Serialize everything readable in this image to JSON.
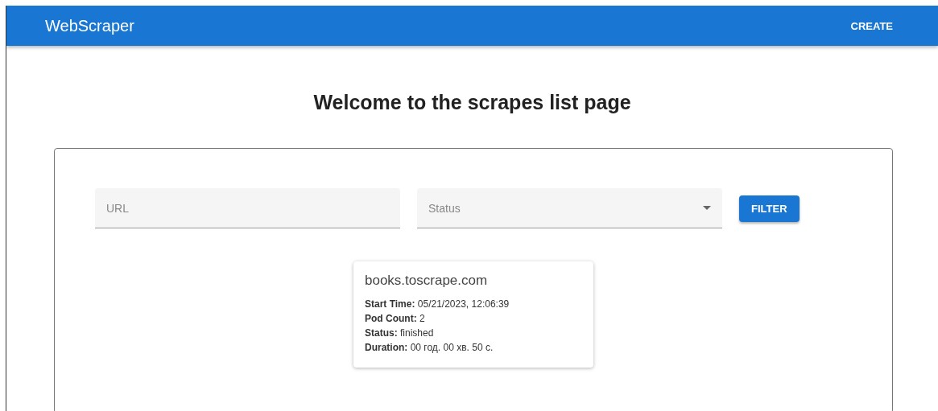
{
  "app_bar": {
    "title": "WebScraper",
    "actions": [
      "CREATE"
    ]
  },
  "heading": "Welcome to the scrapes list page",
  "filters": {
    "url": {
      "placeholder": "URL"
    },
    "status": {
      "placeholder": "Status"
    },
    "button": "FILTER"
  },
  "scrapes": [
    {
      "url": "books.toscrape.com",
      "details": [
        "**Start Time:** 05/21/2023, 12:06:39",
        "**Pod Count:** 2",
        "**Status:** finished",
        "**Duration:** 00 год. 00 хв. 50 с."
      ]
    }
  ]
}
